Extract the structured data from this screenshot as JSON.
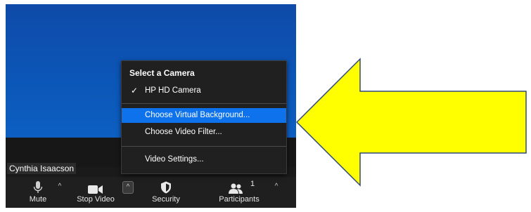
{
  "participant_name": "Cynthia Isaacson",
  "menu": {
    "heading": "Select a Camera",
    "camera_item": "HP HD Camera",
    "camera_check": "✓",
    "virtual_background": "Choose Virtual Background...",
    "video_filter": "Choose Video Filter...",
    "video_settings": "Video Settings..."
  },
  "toolbar": {
    "mute_label": "Mute",
    "stop_video_label": "Stop Video",
    "security_label": "Security",
    "participants_label": "Participants",
    "participants_count": "1",
    "caret": "^"
  },
  "colors": {
    "arrow_fill": "#ffff00",
    "arrow_stroke": "#2f4a7a",
    "selection": "#0e72ed"
  }
}
